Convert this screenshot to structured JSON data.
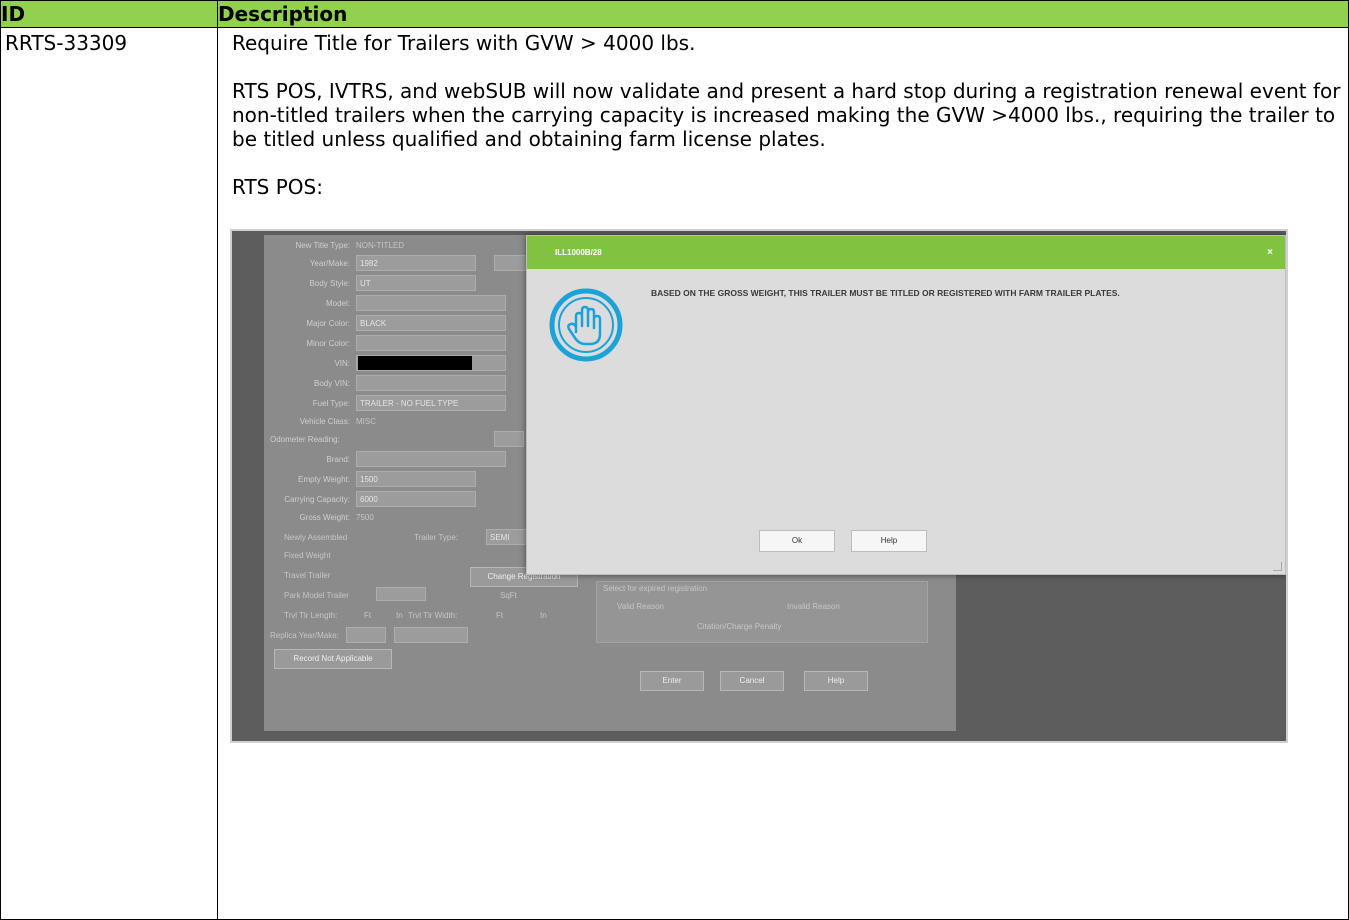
{
  "table": {
    "header_id": "ID",
    "header_description": "Description",
    "row": {
      "id": "RRTS-33309",
      "title": "Require Title for Trailers with GVW > 4000 lbs.",
      "paragraph": "RTS POS, IVTRS, and webSUB will now validate and present a hard stop during a registration renewal event for non-titled trailers when the carrying capacity is increased making the GVW >4000 lbs., requiring the trailer to be titled unless qualified and obtaining farm license plates.",
      "subheading": "RTS POS:"
    }
  },
  "screenshot": {
    "dialog": {
      "title": "ILL1000B/28",
      "message": "BASED ON THE GROSS WEIGHT, THIS TRAILER MUST BE TITLED OR REGISTERED WITH FARM TRAILER PLATES.",
      "ok_label": "Ok",
      "help_label": "Help",
      "close_glyph": "×",
      "icon": "stop-hand-icon"
    },
    "form": {
      "new_title_type_label": "New Title Type:",
      "new_title_type_value": "NON-TITLED",
      "year_make_label": "Year/Make:",
      "year_value": "1982",
      "body_style_label": "Body Style:",
      "body_style_value": "UT",
      "model_label": "Model:",
      "major_color_label": "Major Color:",
      "major_color_value": "BLACK",
      "minor_color_label": "Minor Color:",
      "vin_label": "VIN:",
      "body_vin_label": "Body VIN:",
      "fuel_type_label": "Fuel Type:",
      "fuel_type_value": "TRAILER - NO FUEL TYPE",
      "vehicle_class_label": "Vehicle Class:",
      "vehicle_class_value": "MISC",
      "odometer_label": "Odometer Reading:",
      "brand_label": "Brand:",
      "empty_weight_label": "Empty Weight:",
      "empty_weight_value": "1500",
      "carrying_capacity_label": "Carrying Capacity:",
      "carrying_capacity_value": "6000",
      "gross_weight_label": "Gross Weight:",
      "gross_weight_value": "7500",
      "newly_assembled_label": "Newly Assembled",
      "trailer_type_label": "Trailer Type:",
      "trailer_type_value": "SEMI",
      "fixed_weight_label": "Fixed Weight",
      "travel_trailer_label": "Travel Trailer",
      "change_registration_label": "Change Registration",
      "park_model_label": "Park Model Trailer",
      "sqft_label": "SqFt",
      "trvl_length_label": "Trvl Tlr Length:",
      "ft_label": "Ft",
      "in_label": "In",
      "trvl_width_label": "Trvl Tlr Width:",
      "replica_label": "Replica Year/Make:",
      "record_not_applicable_label": "Record Not Applicable",
      "expired_reg_label": "Select for expired registration",
      "valid_reason_label": "Valid Reason",
      "invalid_reason_label": "Invalid Reason",
      "citation_label": "Citation/Charge Penalty",
      "enter_label": "Enter",
      "cancel_label": "Cancel",
      "help_label": "Help"
    }
  },
  "colors": {
    "header_green": "#92d050",
    "dialog_title_green": "#80c340",
    "icon_blue": "#1aa3d9"
  }
}
